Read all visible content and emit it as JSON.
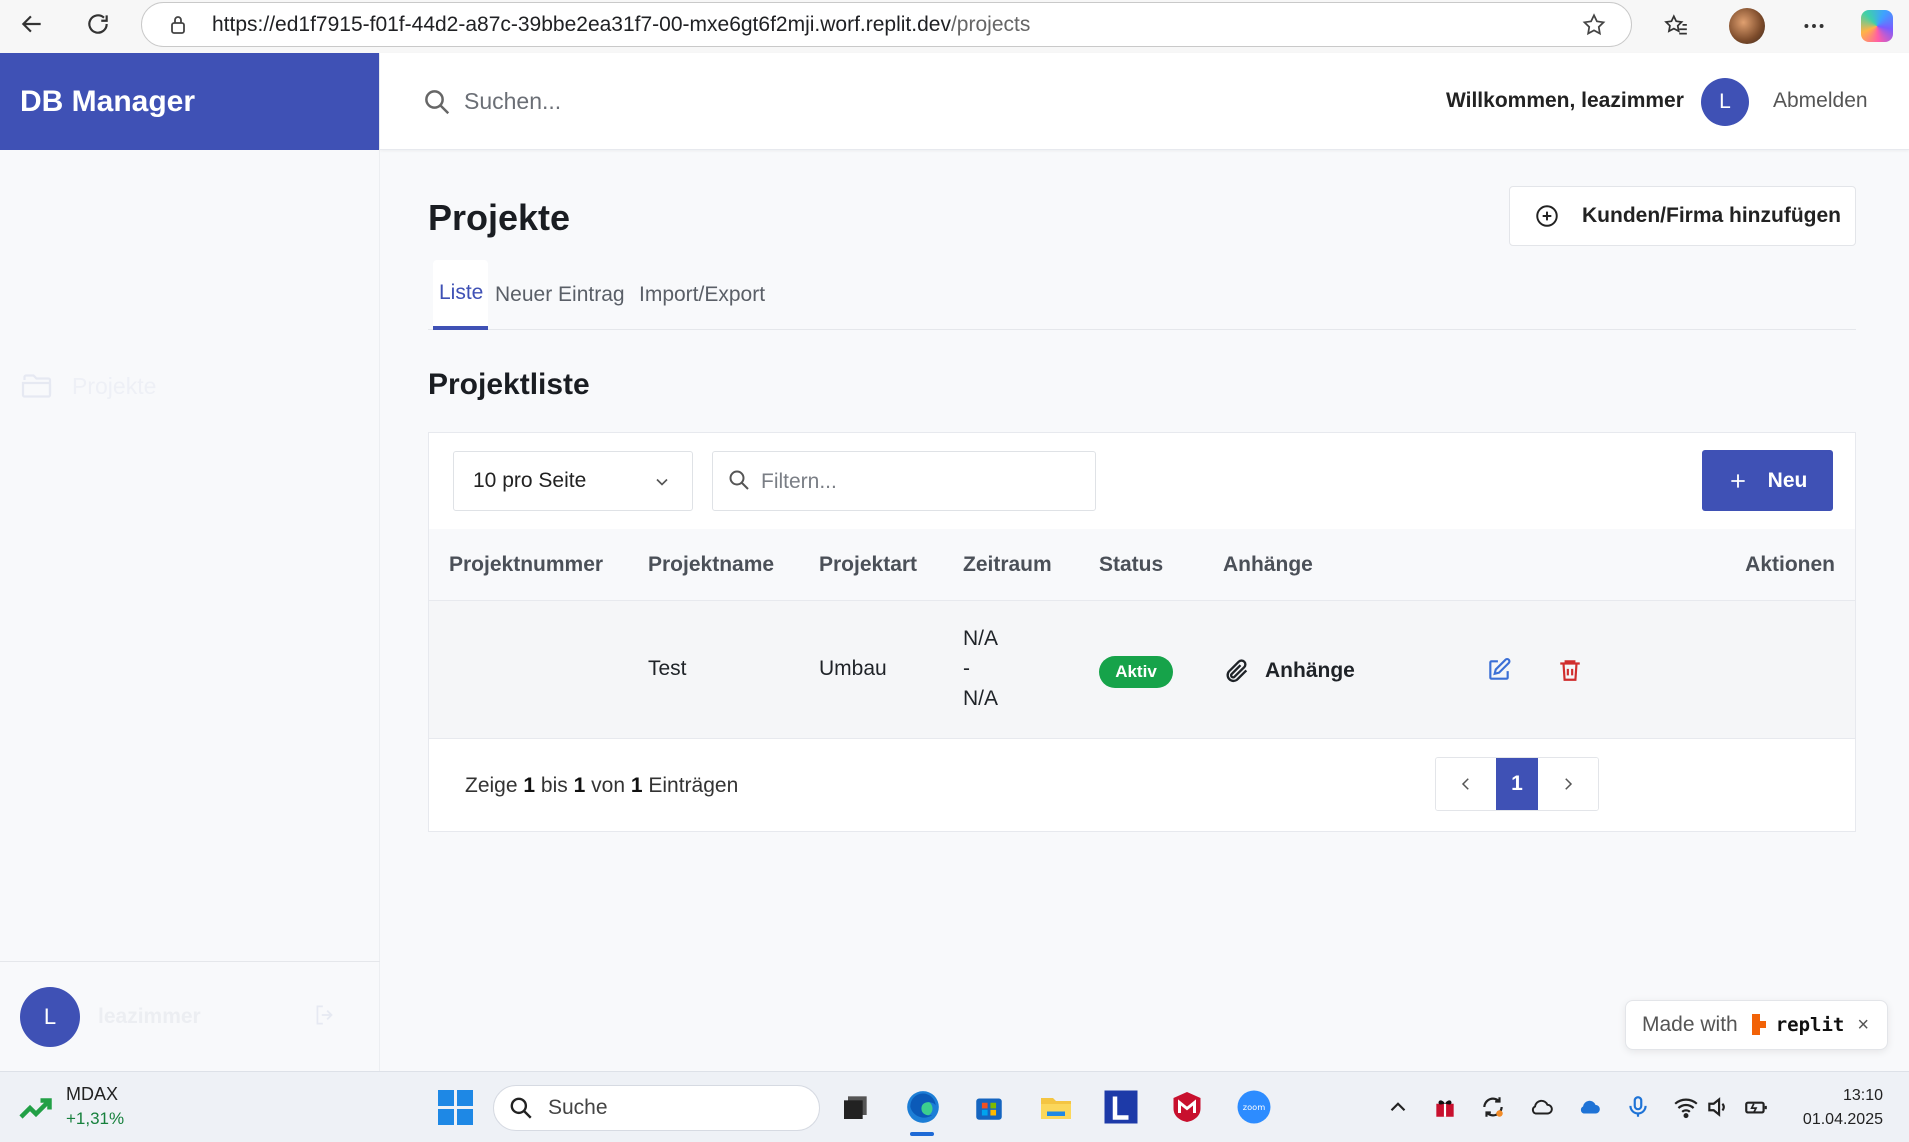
{
  "browser": {
    "url_main": "https://ed1f7915-f01f-44d2-a87c-39bbe2ea31f7-00-mxe6gt6f2mji.worf.replit.dev",
    "url_path": "/projects"
  },
  "app": {
    "brand": "DB Manager",
    "search_placeholder": "Suchen...",
    "welcome": "Willkommen, leazimmer",
    "avatar_letter": "L",
    "logout_label": "Abmelden"
  },
  "sidebar": {
    "items": [
      {
        "label": "Projekte",
        "icon": "folder-icon"
      }
    ],
    "user": {
      "avatar_letter": "L",
      "name": "leazimmer"
    }
  },
  "page": {
    "title": "Projekte",
    "add_company_label": "Kunden/Firma hinzufügen",
    "tabs": [
      {
        "label": "Liste",
        "active": true
      },
      {
        "label": "Neuer Eintrag",
        "active": false
      },
      {
        "label": "Import/Export",
        "active": false
      }
    ],
    "section_title": "Projektliste"
  },
  "table": {
    "per_page": "10 pro Seite",
    "filter_placeholder": "Filtern...",
    "new_label": "Neu",
    "columns": [
      "Projektnummer",
      "Projektname",
      "Projektart",
      "Zeitraum",
      "Status",
      "Anhänge",
      "Aktionen"
    ],
    "rows": [
      {
        "projektnummer": "",
        "projektname": "Test",
        "projektart": "Umbau",
        "zeitraum_start": "N/A",
        "zeitraum_sep": "-",
        "zeitraum_end": "N/A",
        "status": "Aktiv",
        "anhaenge": "Anhänge"
      }
    ],
    "summary": {
      "prefix": "Zeige",
      "from": "1",
      "to_word": "bis",
      "to": "1",
      "of_word": "von",
      "total": "1",
      "suffix": "Einträgen"
    },
    "current_page": "1"
  },
  "replit_badge": {
    "made_with": "Made with",
    "brand": "replit",
    "close": "×"
  },
  "taskbar": {
    "widget_name": "MDAX",
    "widget_value": "+1,31%",
    "search_label": "Suche",
    "time": "13:10",
    "date": "01.04.2025"
  },
  "colors": {
    "accent": "#3f51b5",
    "status_active": "#16a34a",
    "delete": "#d02d2d"
  }
}
